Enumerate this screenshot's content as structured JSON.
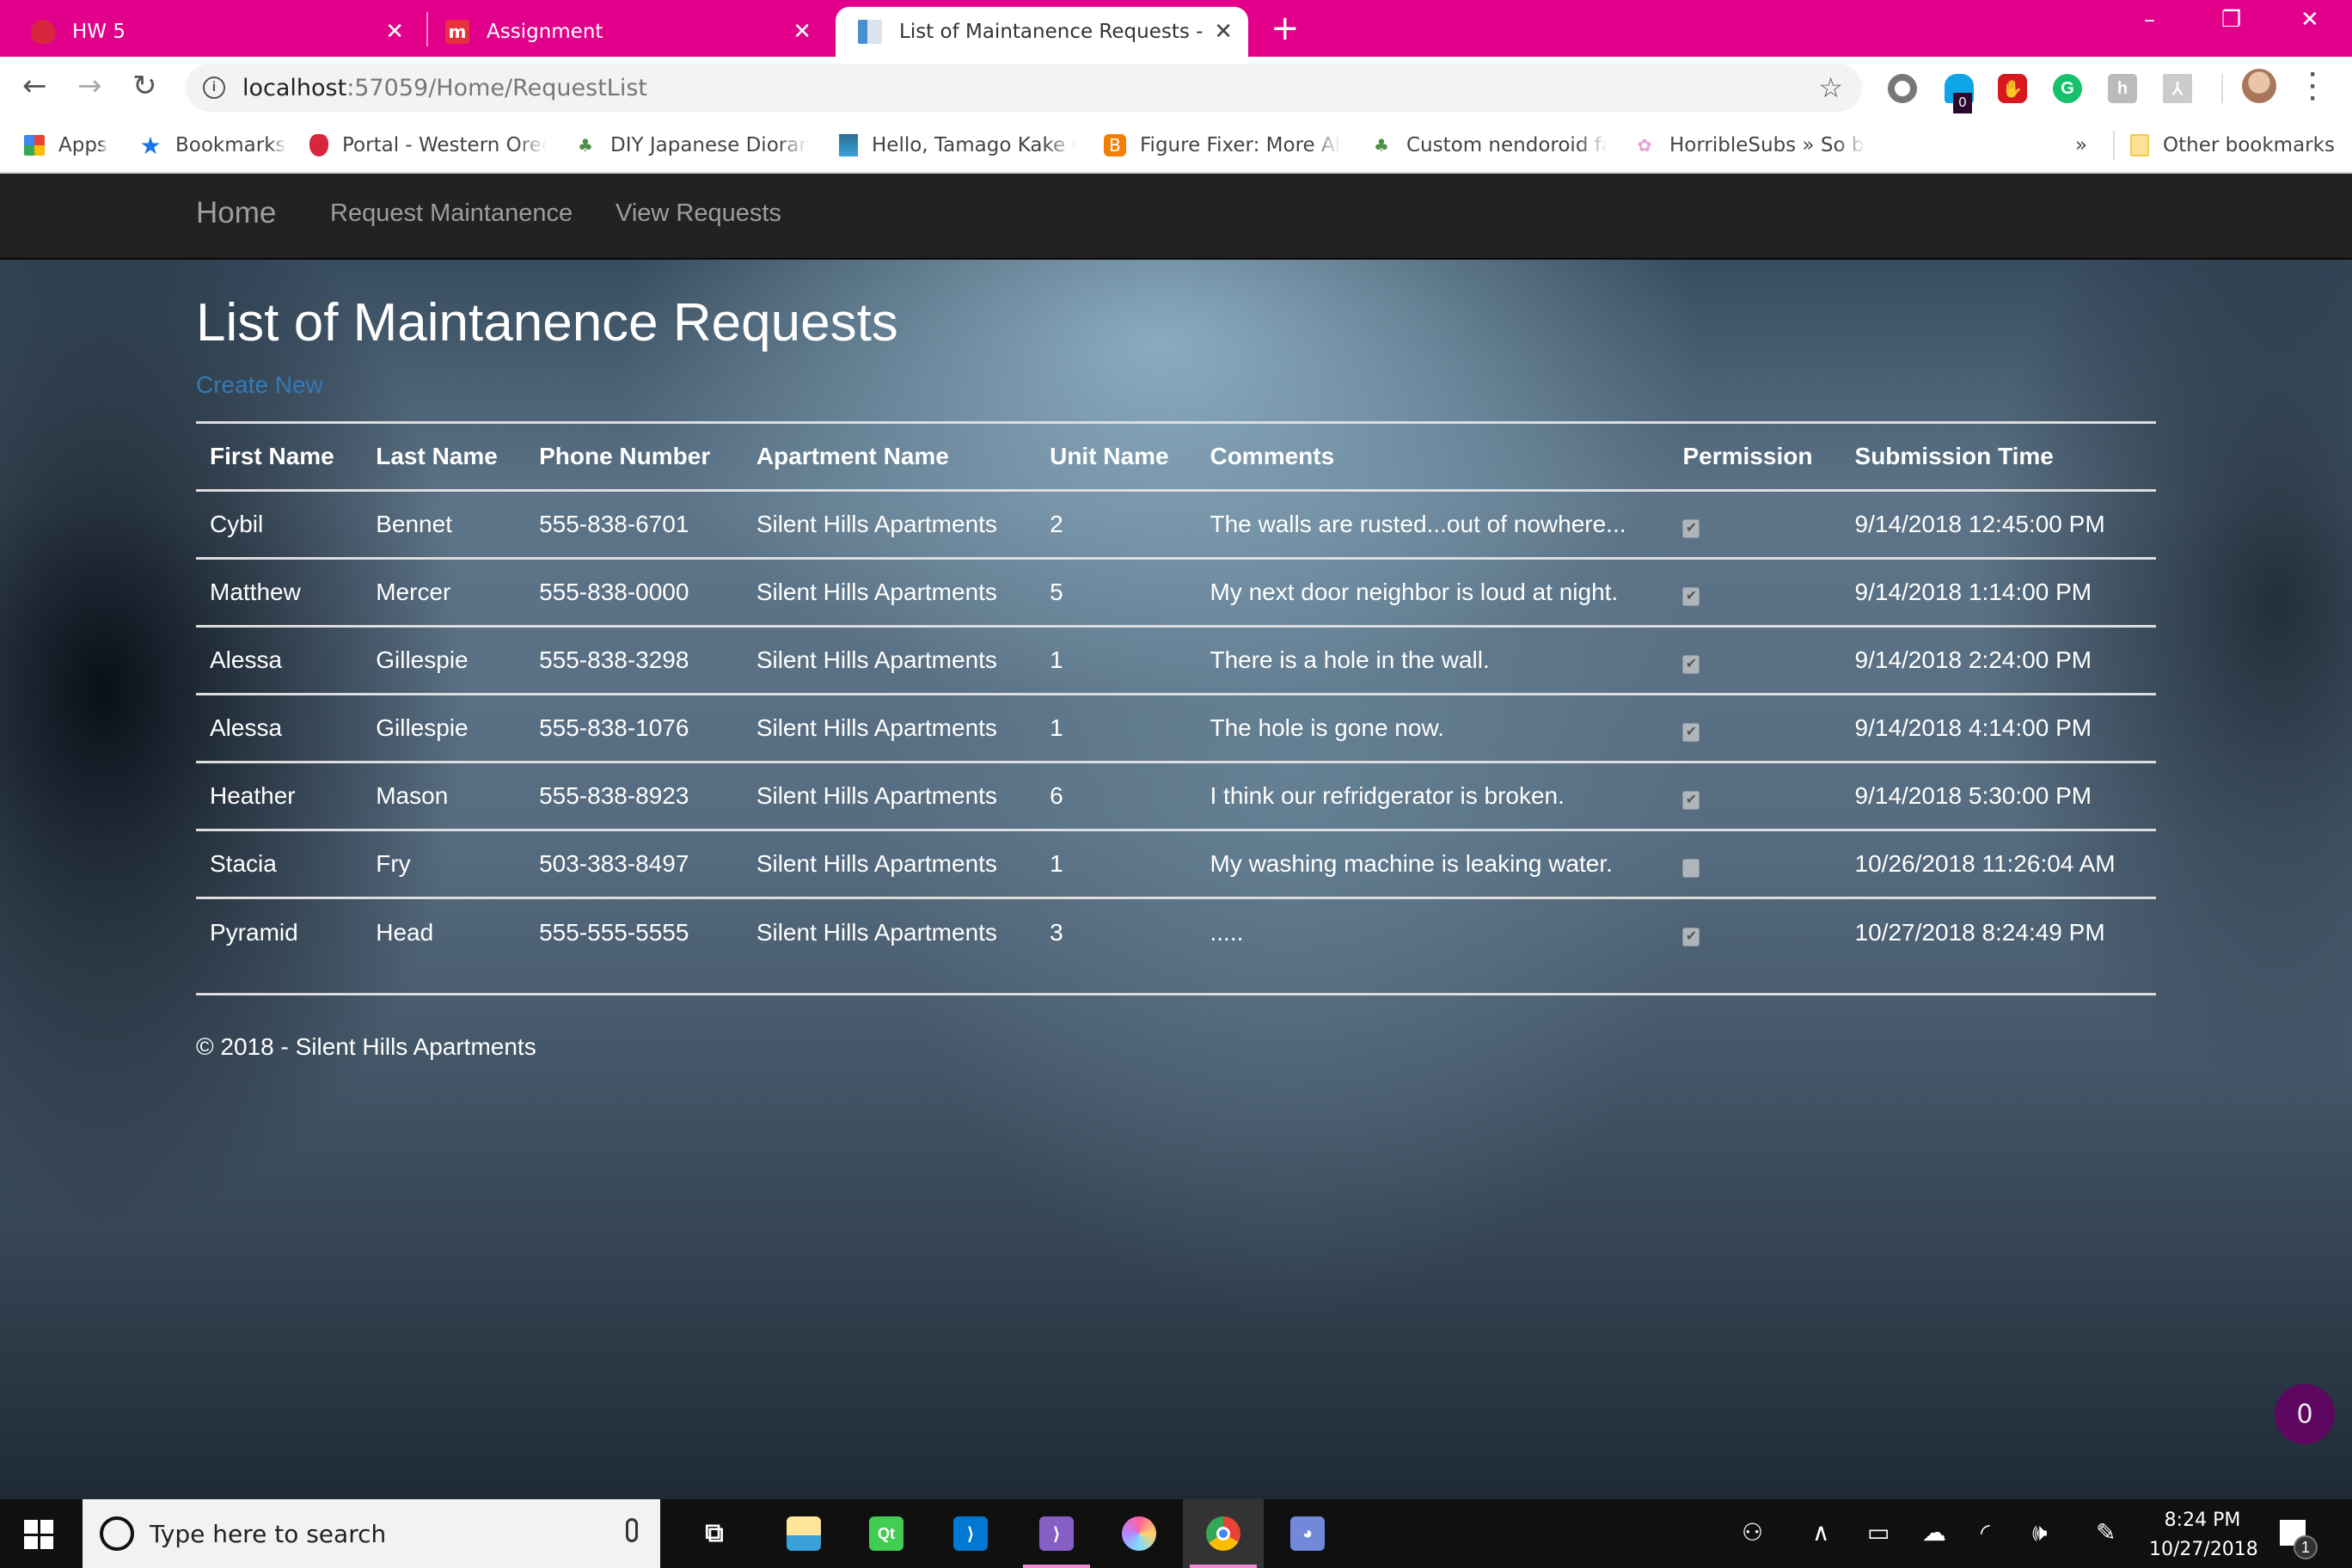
{
  "browser": {
    "tabs": [
      {
        "title": "HW 5",
        "favicon": "wou-shield-icon",
        "active": false
      },
      {
        "title": "Assignment",
        "favicon": "moodle-m-icon",
        "active": false
      },
      {
        "title": "List of Maintanence Requests - M",
        "favicon": "document-page-icon",
        "active": true
      }
    ],
    "tab_close_glyph": "✕",
    "new_tab_glyph": "+",
    "window_controls": {
      "minimize": "–",
      "restore": "❐",
      "close": "✕"
    },
    "address": {
      "host": "localhost",
      "rest": ":57059/Home/RequestList"
    },
    "extensions": [
      "circle-extension-icon",
      "ghostery-icon",
      "adblock-icon",
      "grammarly-icon",
      "honey-icon",
      "acrobat-icon"
    ],
    "extension_badge": "0",
    "bookmarks": [
      {
        "label": "Apps",
        "icon": "apps-grid-icon"
      },
      {
        "label": "Bookmarks",
        "icon": "star-icon"
      },
      {
        "label": "Portal - Western Oreg",
        "icon": "wou-shield-icon"
      },
      {
        "label": "DIY Japanese Dioram",
        "icon": "leaf-icon"
      },
      {
        "label": "Hello, Tamago Kake G",
        "icon": "trash-can-icon"
      },
      {
        "label": "Figure Fixer: More Ab",
        "icon": "blogger-icon"
      },
      {
        "label": "Custom nendoroid fa",
        "icon": "leaf-icon"
      },
      {
        "label": "HorribleSubs » So ba",
        "icon": "maple-leaf-icon"
      }
    ],
    "bookmarks_overflow": "»",
    "other_bookmarks": "Other bookmarks"
  },
  "site": {
    "nav": {
      "brand": "Home",
      "links": [
        "Request Maintanence",
        "View Requests"
      ]
    },
    "title": "List of Maintanence Requests",
    "create_new": "Create New",
    "table": {
      "headers": [
        "First Name",
        "Last Name",
        "Phone Number",
        "Apartment Name",
        "Unit Name",
        "Comments",
        "Permission",
        "Submission Time"
      ],
      "rows": [
        {
          "first": "Cybil",
          "last": "Bennet",
          "phone": "555-838-6701",
          "apartment": "Silent Hills Apartments",
          "unit": "2",
          "comments": "The walls are rusted...out of nowhere...",
          "permission": true,
          "time": "9/14/2018 12:45:00 PM"
        },
        {
          "first": "Matthew",
          "last": "Mercer",
          "phone": "555-838-0000",
          "apartment": "Silent Hills Apartments",
          "unit": "5",
          "comments": "My next door neighbor is loud at night.",
          "permission": true,
          "time": "9/14/2018 1:14:00 PM"
        },
        {
          "first": "Alessa",
          "last": "Gillespie",
          "phone": "555-838-3298",
          "apartment": "Silent Hills Apartments",
          "unit": "1",
          "comments": "There is a hole in the wall.",
          "permission": true,
          "time": "9/14/2018 2:24:00 PM"
        },
        {
          "first": "Alessa",
          "last": "Gillespie",
          "phone": "555-838-1076",
          "apartment": "Silent Hills Apartments",
          "unit": "1",
          "comments": "The hole is gone now.",
          "permission": true,
          "time": "9/14/2018 4:14:00 PM"
        },
        {
          "first": "Heather",
          "last": "Mason",
          "phone": "555-838-8923",
          "apartment": "Silent Hills Apartments",
          "unit": "6",
          "comments": "I think our refridgerator is broken.",
          "permission": true,
          "time": "9/14/2018 5:30:00 PM"
        },
        {
          "first": "Stacia",
          "last": "Fry",
          "phone": "503-383-8497",
          "apartment": "Silent Hills Apartments",
          "unit": "1",
          "comments": "My washing machine is leaking water.",
          "permission": false,
          "time": "10/26/2018 11:26:04 AM"
        },
        {
          "first": "Pyramid",
          "last": "Head",
          "phone": "555-555-5555",
          "apartment": "Silent Hills Apartments",
          "unit": "3",
          "comments": ".....",
          "permission": true,
          "time": "10/27/2018 8:24:49 PM"
        }
      ]
    },
    "footer": "© 2018 - Silent Hills Apartments",
    "notification_count": "0"
  },
  "taskbar": {
    "search_placeholder": "Type here to search",
    "apps": [
      {
        "name": "task-view",
        "running": false
      },
      {
        "name": "file-explorer",
        "running": false
      },
      {
        "name": "qt-creator",
        "running": false
      },
      {
        "name": "vs-code",
        "running": false
      },
      {
        "name": "visual-studio",
        "running": true
      },
      {
        "name": "paint-app",
        "running": false
      },
      {
        "name": "chrome",
        "running": true,
        "active": true
      },
      {
        "name": "discord",
        "running": false
      }
    ],
    "clock_time": "8:24 PM",
    "clock_date": "10/27/2018",
    "notification_badge": "1"
  },
  "colors": {
    "tab_strip": "#e2008b",
    "navbar": "#222222",
    "link": "#337ab7",
    "notif_bubble": "#5e0760"
  }
}
